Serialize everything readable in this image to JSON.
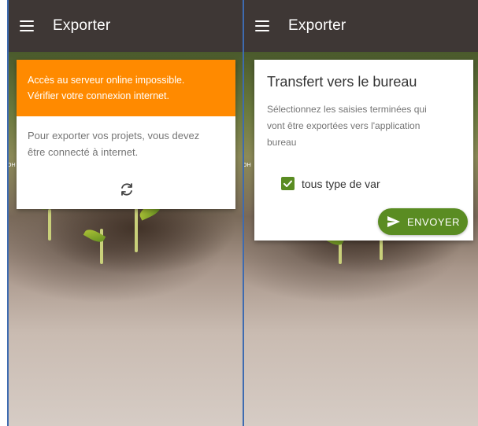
{
  "screens": [
    {
      "appbar": {
        "title": "Exporter",
        "menu_icon": "hamburger-menu-icon"
      },
      "alert": {
        "line1": "Accès au serveur online impossible.",
        "line2": "Vérifier votre connexion internet.",
        "color": "#ff8a00"
      },
      "message": {
        "line1": "Pour exporter vos projets, vous devez",
        "line2": "être connecté à internet."
      },
      "refresh_icon": "sync-icon"
    },
    {
      "appbar": {
        "title": "Exporter",
        "menu_icon": "hamburger-menu-icon"
      },
      "card": {
        "title": "Transfert vers le bureau",
        "desc_line1": "Sélectionnez les saisies terminées qui",
        "desc_line2": "vont être exportées vers l'application",
        "desc_line3": "bureau"
      },
      "checkbox": {
        "label": "tous type de var",
        "checked": true,
        "color": "#5a8c22"
      },
      "send_button": {
        "label": "ENVOYER",
        "icon": "send-icon",
        "color": "#5a8c22"
      }
    }
  ],
  "theme": {
    "appbar_color": "#3e3735"
  }
}
